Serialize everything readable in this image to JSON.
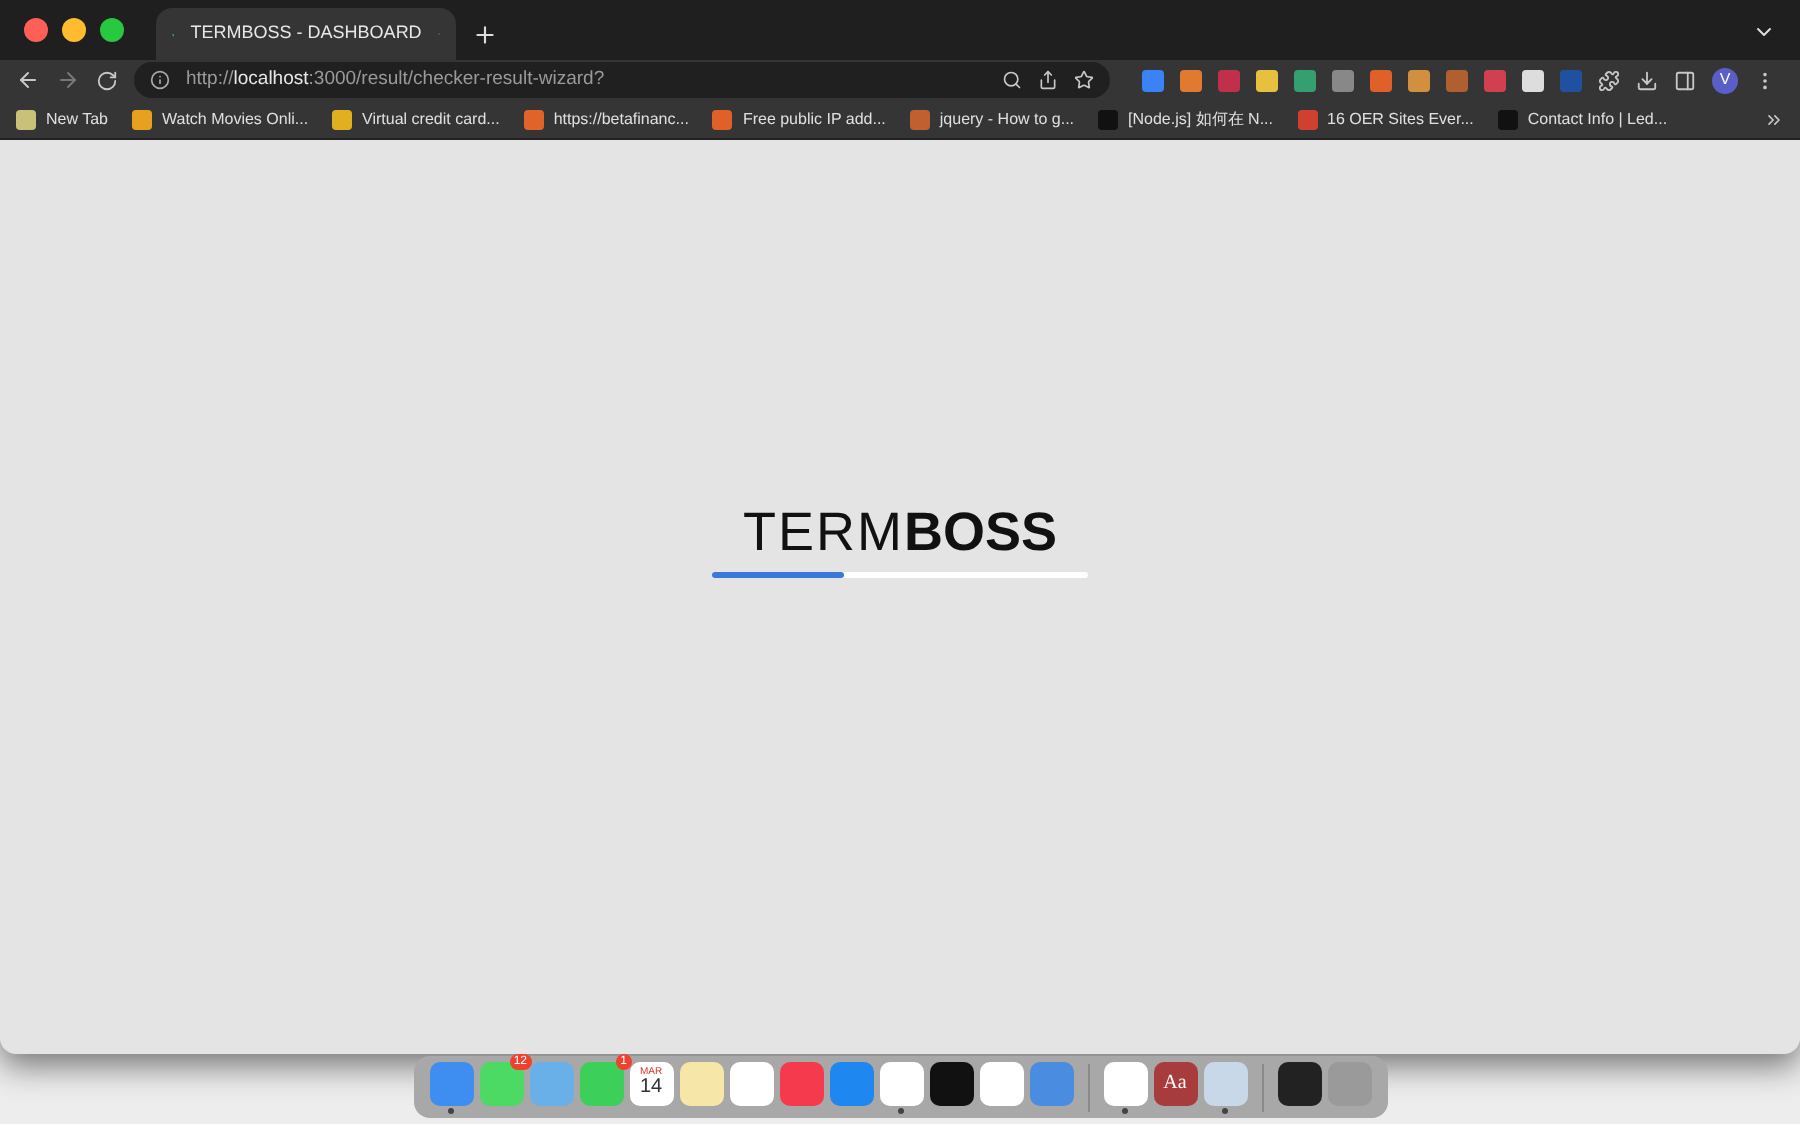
{
  "tabs": [
    {
      "title": "TERMBOSS - DASHBOARD",
      "selected": true
    }
  ],
  "address": {
    "scheme": "http://",
    "host": "localhost",
    "rest": ":3000/result/checker-result-wizard?"
  },
  "bookmarks": [
    {
      "label": "New Tab",
      "color": "#c9c07a"
    },
    {
      "label": "Watch Movies Onli...",
      "color": "#e8a020"
    },
    {
      "label": "Virtual credit card...",
      "color": "#e0b020"
    },
    {
      "label": "https://betafinanc...",
      "color": "#e0642a"
    },
    {
      "label": "Free public IP add...",
      "color": "#e0602a"
    },
    {
      "label": "jquery - How to g...",
      "color": "#c06030"
    },
    {
      "label": "[Node.js] 如何在 N...",
      "color": "#111111"
    },
    {
      "label": "16 OER Sites Ever...",
      "color": "#d04030"
    },
    {
      "label": "Contact Info | Led...",
      "color": "#111111"
    }
  ],
  "extensions": [
    {
      "color": "#3b82f6"
    },
    {
      "color": "#e07a30"
    },
    {
      "color": "#c0304a"
    },
    {
      "color": "#e8c040"
    },
    {
      "color": "#34a070"
    },
    {
      "color": "#888888"
    },
    {
      "color": "#e0602a"
    },
    {
      "color": "#d09040"
    },
    {
      "color": "#b06030"
    },
    {
      "color": "#d04050"
    },
    {
      "color": "#dddddd"
    },
    {
      "color": "#2050a0"
    }
  ],
  "profile": "V",
  "logo": {
    "light": "TERM",
    "bold": "BOSS"
  },
  "loader": {
    "level": 0.35
  },
  "dock": [
    {
      "color": "#3d8ef0",
      "running": true
    },
    {
      "color": "#4cd964",
      "badge": "12",
      "running": false
    },
    {
      "color": "#6ab0e8",
      "running": false
    },
    {
      "color": "#3ccf5a",
      "badge": "1",
      "running": false
    },
    {
      "color": "#ffffff",
      "kind": "calendar",
      "month": "MAR",
      "day": "14",
      "running": false
    },
    {
      "color": "#f6e7a8",
      "running": false
    },
    {
      "color": "#ffffff",
      "running": false
    },
    {
      "color": "#f43a4c",
      "running": false
    },
    {
      "color": "#1e88f0",
      "running": false
    },
    {
      "color": "#ffffff",
      "running": true
    },
    {
      "color": "#111111",
      "running": false
    },
    {
      "color": "#ffffff",
      "running": false
    },
    {
      "color": "#4a8ce0",
      "running": false
    },
    {
      "kind": "divider"
    },
    {
      "color": "#ffffff",
      "running": true
    },
    {
      "color": "#a83c3c",
      "kind": "text",
      "text": "Aa",
      "running": false
    },
    {
      "color": "#c8d8e8",
      "running": true
    },
    {
      "kind": "divider"
    },
    {
      "color": "#222222",
      "running": false
    },
    {
      "color": "#9a9a9a",
      "running": false
    }
  ]
}
